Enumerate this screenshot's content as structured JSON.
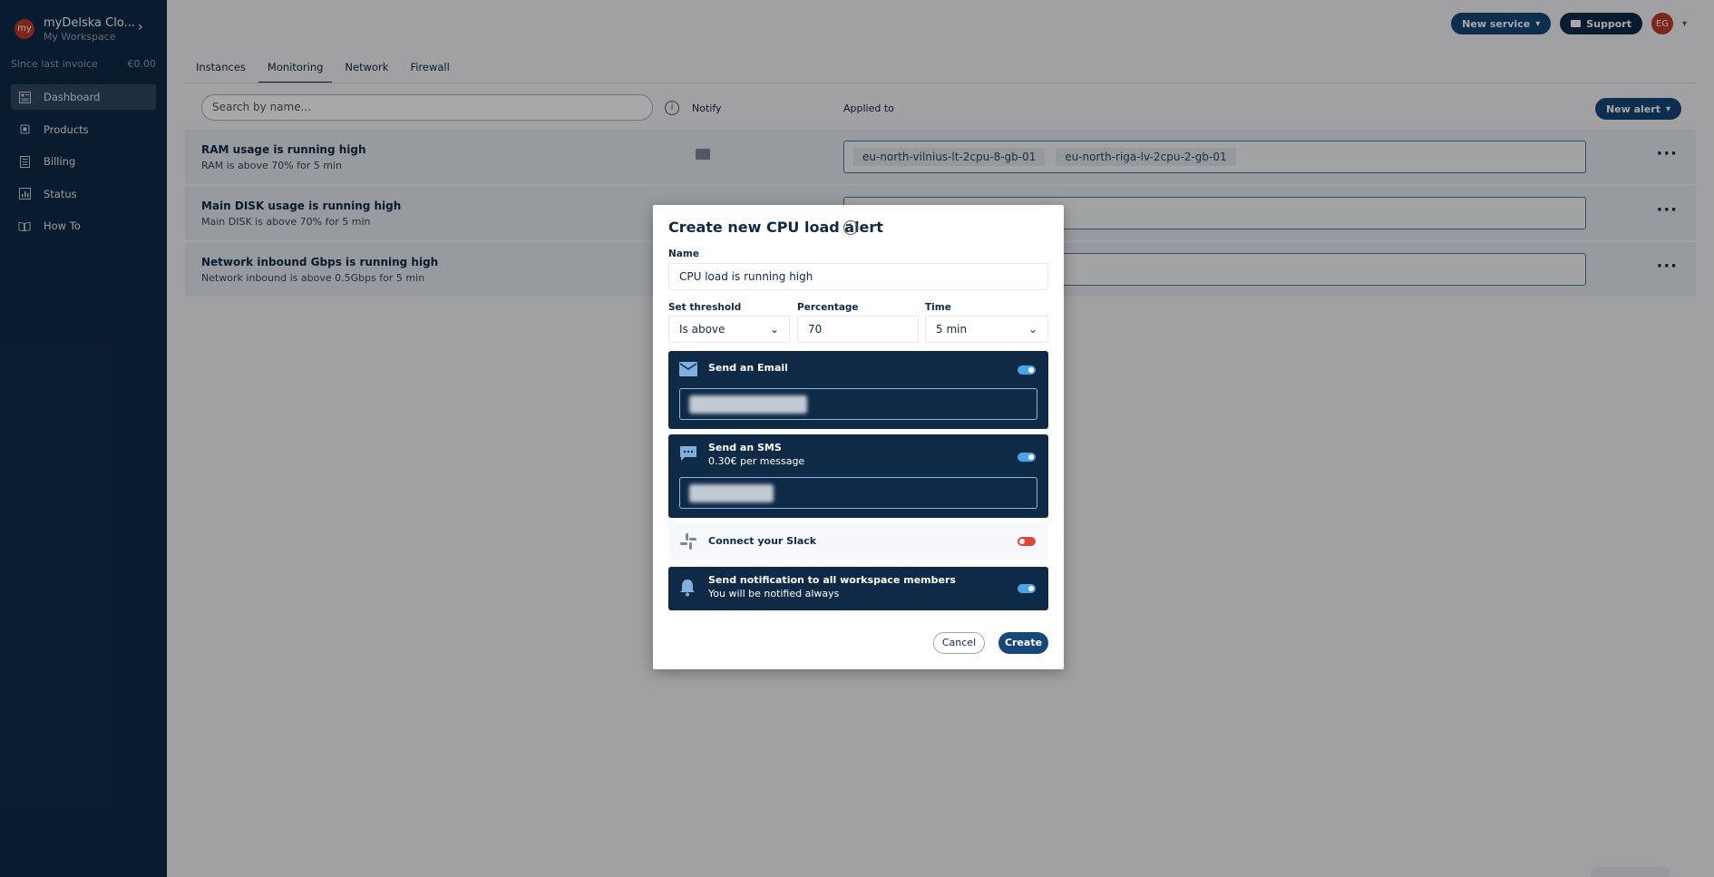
{
  "sidebar": {
    "workspace": {
      "avatar": "my",
      "name": "myDelska Clo...",
      "sub": "My Workspace"
    },
    "invoice": {
      "label": "Since last invoice",
      "amount": "€0.00"
    },
    "items": [
      {
        "label": "Dashboard",
        "icon": "dashboard-icon",
        "active": true
      },
      {
        "label": "Products",
        "icon": "products-icon"
      },
      {
        "label": "Billing",
        "icon": "billing-icon"
      },
      {
        "label": "Status",
        "icon": "status-icon"
      },
      {
        "label": "How To",
        "icon": "book-icon"
      }
    ]
  },
  "header": {
    "new_service": "New service",
    "support": "Support",
    "avatar": "EG"
  },
  "tabs": [
    "Instances",
    "Monitoring",
    "Network",
    "Firewall"
  ],
  "toolbar": {
    "search_placeholder": "Search by name...",
    "notify": "Notify",
    "applied_to": "Applied to",
    "new_alert": "New alert"
  },
  "alerts": [
    {
      "title": "RAM usage is running high",
      "sub": "RAM is above 70% for 5 min",
      "chips": [
        "eu-north-vilnius-lt-2cpu-8-gb-01",
        "eu-north-riga-lv-2cpu-2-gb-01"
      ]
    },
    {
      "title": "Main DISK usage is running high",
      "sub": "Main DISK is above 70% for 5 min",
      "chips": []
    },
    {
      "title": "Network inbound Gbps is running high",
      "sub": "Network inbound is above 0.5Gbps for 5 min",
      "chips": []
    }
  ],
  "modal": {
    "title": "Create new CPU load alert",
    "name_label": "Name",
    "name_value": "CPU load is running high",
    "threshold_label": "Set threshold",
    "threshold_value": "Is above",
    "percentage_label": "Percentage",
    "percentage_value": "70",
    "time_label": "Time",
    "time_value": "5 min",
    "email": {
      "title": "Send an Email",
      "enabled": true
    },
    "sms": {
      "title": "Send an SMS",
      "sub": "0.30€ per message",
      "enabled": true
    },
    "slack": {
      "title": "Connect your Slack",
      "enabled": false
    },
    "workspace": {
      "title": "Send notification to all workspace members",
      "sub": "You will be notified always",
      "enabled": true
    },
    "cancel": "Cancel",
    "create": "Create"
  },
  "colors": {
    "navy": "#0f2a47",
    "accent": "#16467a",
    "toggle_on": "#4aa3e8",
    "toggle_off": "#e0453a"
  }
}
